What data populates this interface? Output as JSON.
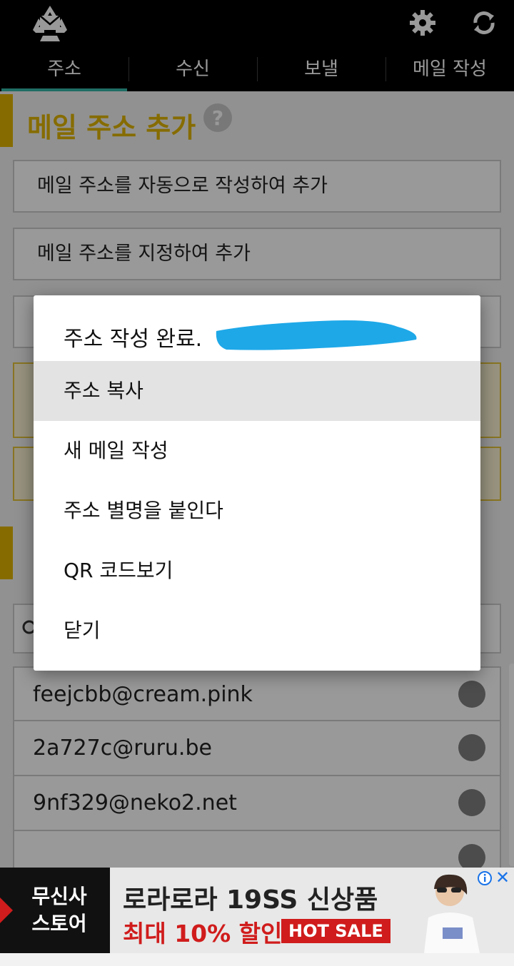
{
  "header": {
    "tabs": [
      {
        "label": "주소"
      },
      {
        "label": "수신"
      },
      {
        "label": "보낼"
      },
      {
        "label": "메일 작성"
      }
    ]
  },
  "main": {
    "section_title": "메일 주소 추가",
    "buttons": [
      {
        "label": "메일 주소를 자동으로 작성하여 추가"
      },
      {
        "label": "메일 주소를 지정하여 추가"
      }
    ],
    "addresses": [
      {
        "email": "feejcbb@cream.pink"
      },
      {
        "email": "2a727c@ruru.be"
      },
      {
        "email": "9nf329@neko2.net"
      }
    ]
  },
  "dialog": {
    "title": "주소 작성 완료.",
    "items": [
      {
        "label": "주소 복사"
      },
      {
        "label": "새 메일 작성"
      },
      {
        "label": "주소 별명을 붙인다"
      },
      {
        "label": "QR 코드보기"
      },
      {
        "label": "닫기"
      }
    ]
  },
  "ad": {
    "brand": "무신사 스토어",
    "headline": "로라로라 19SS 신상품",
    "sub": "최대 10% 할인",
    "badge": "HOT SALE",
    "close": "✕"
  }
}
